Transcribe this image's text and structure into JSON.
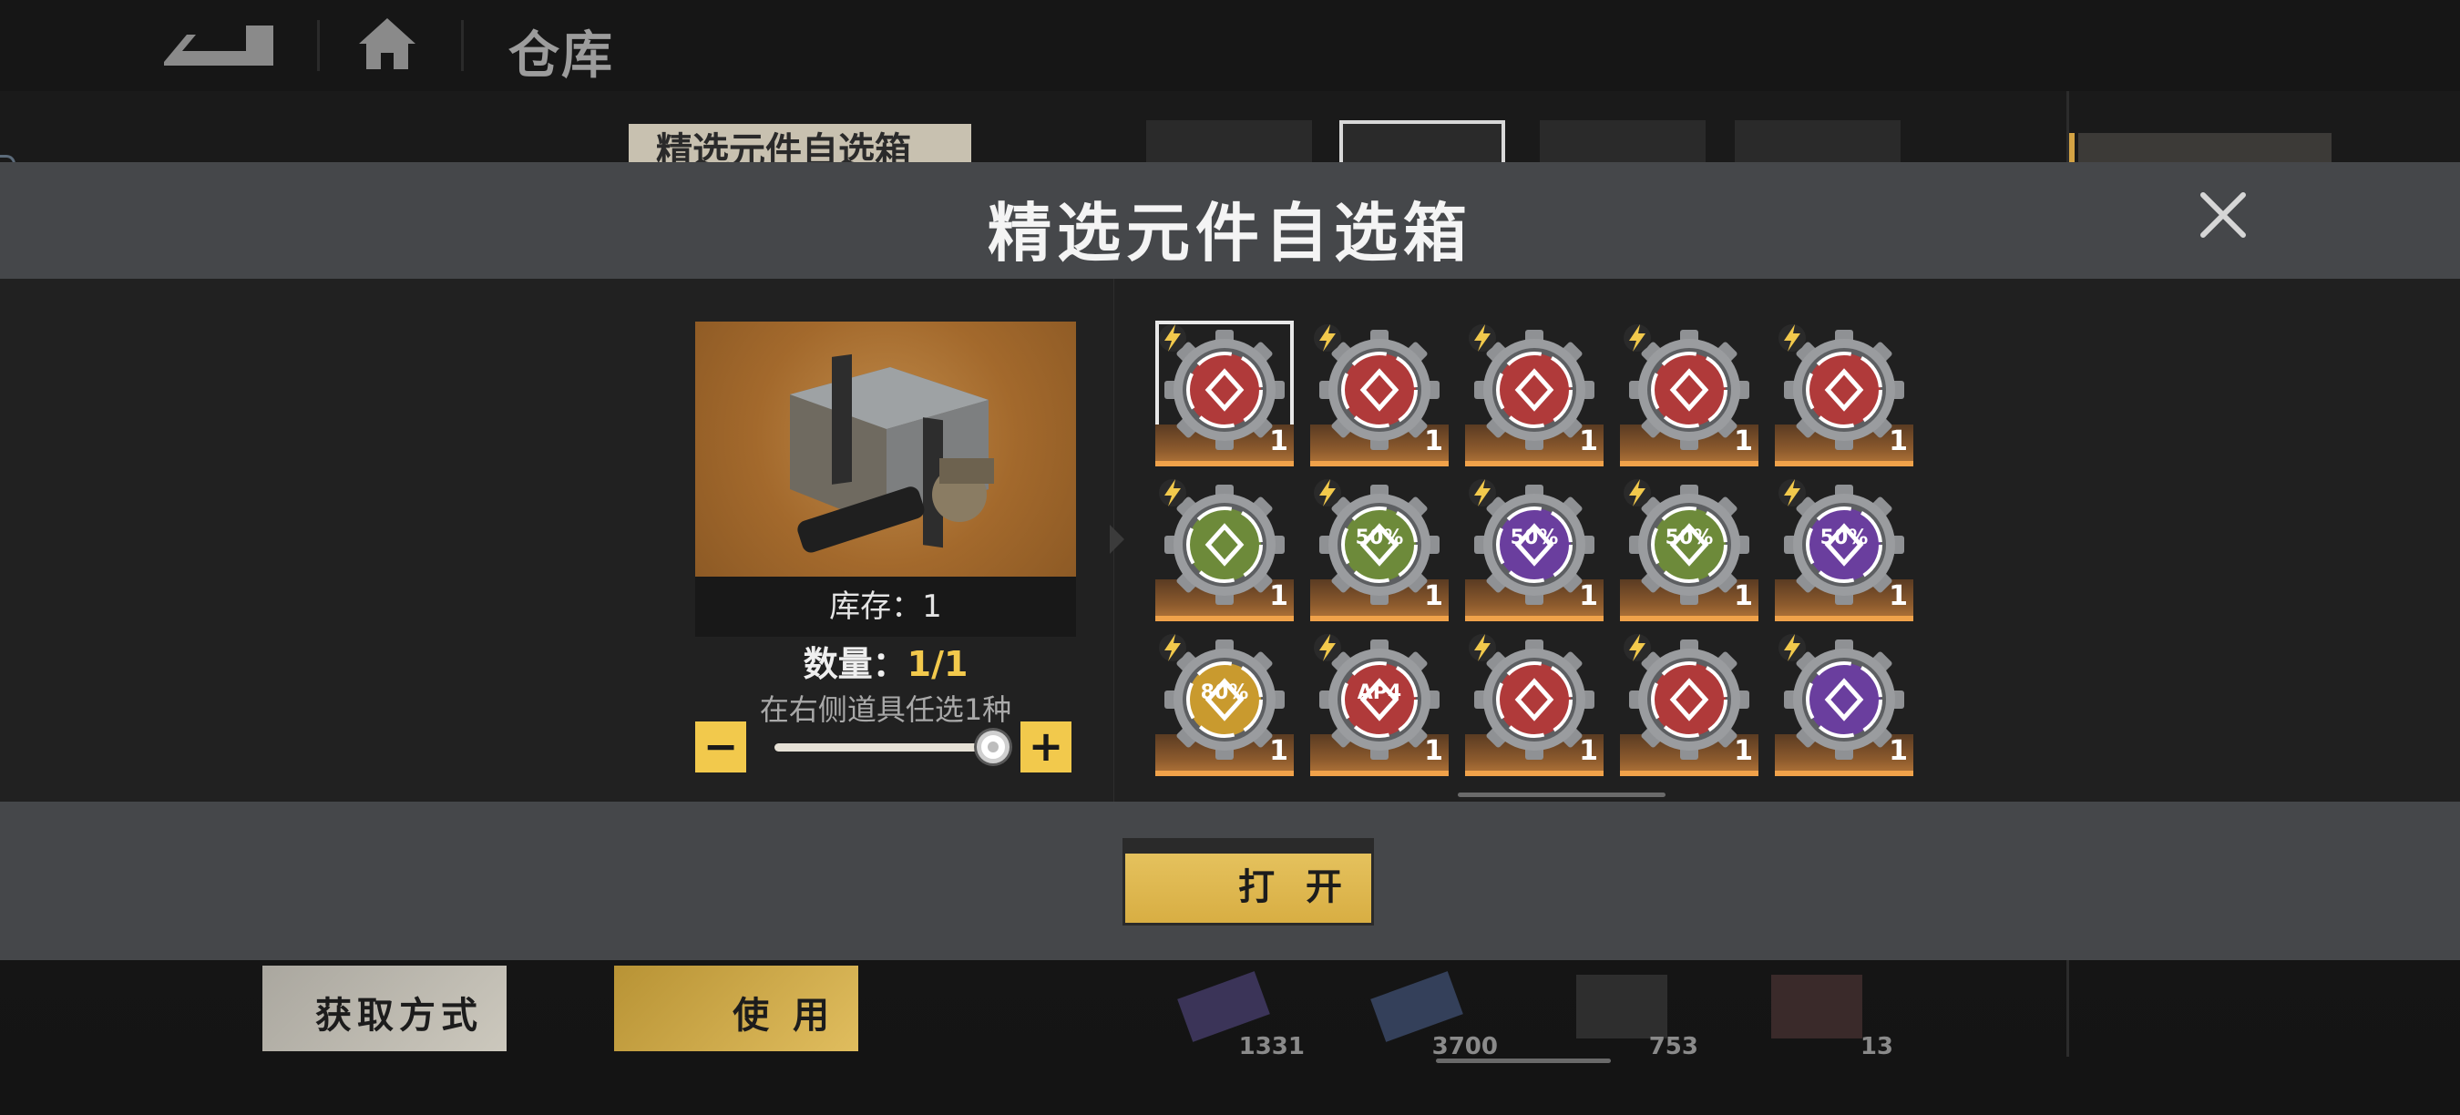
{
  "background": {
    "page_title": "仓库",
    "item_label": "精选元件自选箱",
    "buttons": {
      "acquire": "获取方式",
      "use": "使 用"
    },
    "inventory_counts": [
      "1331",
      "3700",
      "753",
      "13"
    ]
  },
  "modal": {
    "title": "精选元件自选箱",
    "stock_label": "库存：1",
    "quantity_prefix": "数量：",
    "quantity_value": "1/1",
    "hint": "在右侧道具任选1种",
    "minus": "−",
    "plus": "+",
    "slider_fraction": 1.0,
    "open_button": "打 开"
  },
  "items": [
    {
      "icon": "claw-emblem",
      "color": "#b03a3a",
      "count": "1",
      "selected": true
    },
    {
      "icon": "cycle-emblem",
      "color": "#b03a3a",
      "count": "1",
      "selected": false
    },
    {
      "icon": "spear-emblem",
      "color": "#b03a3a",
      "count": "1",
      "selected": false
    },
    {
      "icon": "star-emblem",
      "color": "#b03a3a",
      "count": "1",
      "selected": false
    },
    {
      "icon": "diamond-emblem",
      "color": "#b03a3a",
      "count": "1",
      "selected": false
    },
    {
      "icon": "shield-emblem",
      "color": "#6d8a3a",
      "count": "1",
      "selected": false,
      "label": ""
    },
    {
      "icon": "percent-emblem",
      "color": "#6d8a3a",
      "count": "1",
      "selected": false,
      "label": "50%"
    },
    {
      "icon": "percent-emblem",
      "color": "#6a3e9e",
      "count": "1",
      "selected": false,
      "label": "50%"
    },
    {
      "icon": "percent-emblem",
      "color": "#6d8a3a",
      "count": "1",
      "selected": false,
      "label": "50%"
    },
    {
      "icon": "percent-emblem",
      "color": "#6a3e9e",
      "count": "1",
      "selected": false,
      "label": "50%"
    },
    {
      "icon": "percent-emblem",
      "color": "#c99a2e",
      "count": "1",
      "selected": false,
      "label": "80%"
    },
    {
      "icon": "ap-emblem",
      "color": "#b03a3a",
      "count": "1",
      "selected": false,
      "label": "AP4"
    },
    {
      "icon": "cross-emblem",
      "color": "#b03a3a",
      "count": "1",
      "selected": false
    },
    {
      "icon": "target-emblem",
      "color": "#b03a3a",
      "count": "1",
      "selected": false
    },
    {
      "icon": "ring-emblem",
      "color": "#6a3e9e",
      "count": "1",
      "selected": false
    }
  ]
}
